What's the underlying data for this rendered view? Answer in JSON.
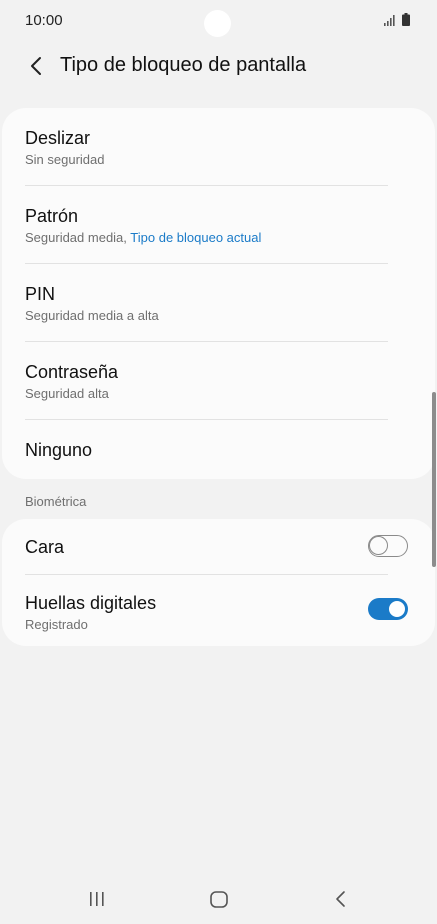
{
  "status_bar": {
    "time": "10:00",
    "icons": [
      "signal-icon",
      "battery-icon"
    ]
  },
  "header": {
    "back_icon": "chevron-left-icon",
    "title": "Tipo de bloqueo de pantalla"
  },
  "lock_options": [
    {
      "title": "Deslizar",
      "subtitle": "Sin seguridad"
    },
    {
      "title": "Patrón",
      "subtitle": "Seguridad media,",
      "subtitle_accent": "Tipo de bloqueo actual"
    },
    {
      "title": "PIN",
      "subtitle": "Seguridad media a alta"
    },
    {
      "title": "Contraseña",
      "subtitle": "Seguridad alta"
    },
    {
      "title": "Ninguno"
    }
  ],
  "biometrics": {
    "section_label": "Biométrica",
    "items": [
      {
        "title": "Cara",
        "toggle": false
      },
      {
        "title": "Huellas digitales",
        "subtitle": "Registrado",
        "toggle": true
      }
    ]
  },
  "colors": {
    "accent": "#1b7bc8",
    "background": "#f2f2f2",
    "card": "#fbfbfb"
  },
  "nav_bar": {
    "icons": [
      "recent-apps-icon",
      "home-icon",
      "back-icon"
    ]
  }
}
